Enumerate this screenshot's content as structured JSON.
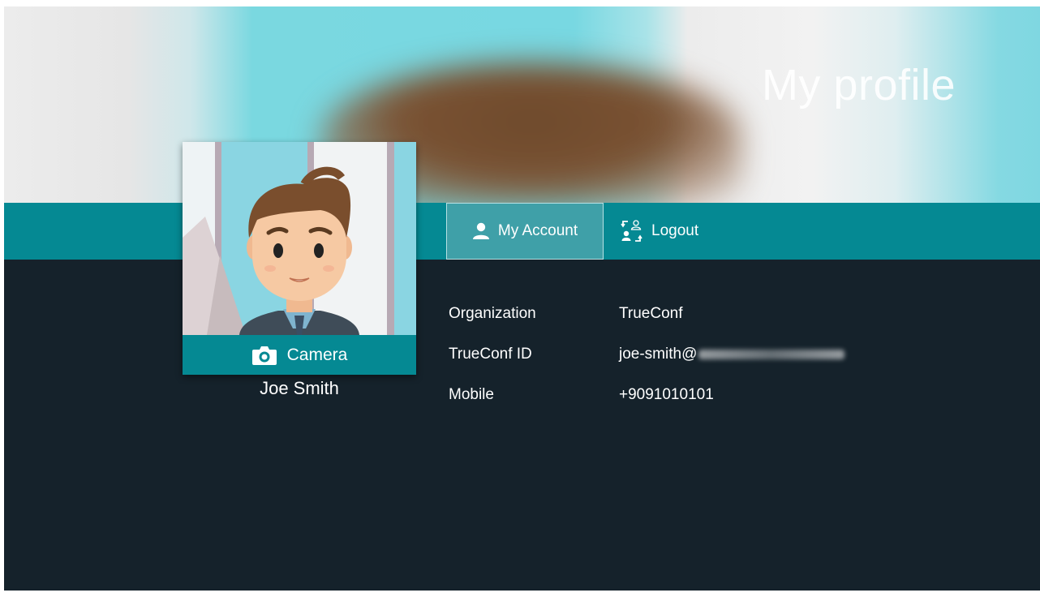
{
  "header": {
    "title": "My profile"
  },
  "tabs": [
    {
      "label": "My Account",
      "icon": "person-icon",
      "active": true
    },
    {
      "label": "Logout",
      "icon": "switch-user-icon",
      "active": false
    }
  ],
  "profile": {
    "name": "Joe Smith",
    "camera_label": "Camera"
  },
  "details": [
    {
      "label": "Organization",
      "value": "TrueConf"
    },
    {
      "label": "TrueConf ID",
      "value": "joe-smith@"
    },
    {
      "label": "Mobile",
      "value": "+9091010101"
    }
  ],
  "colors": {
    "accent": "#058993",
    "background": "#15222b",
    "active_tab": "#3fa0a8"
  }
}
